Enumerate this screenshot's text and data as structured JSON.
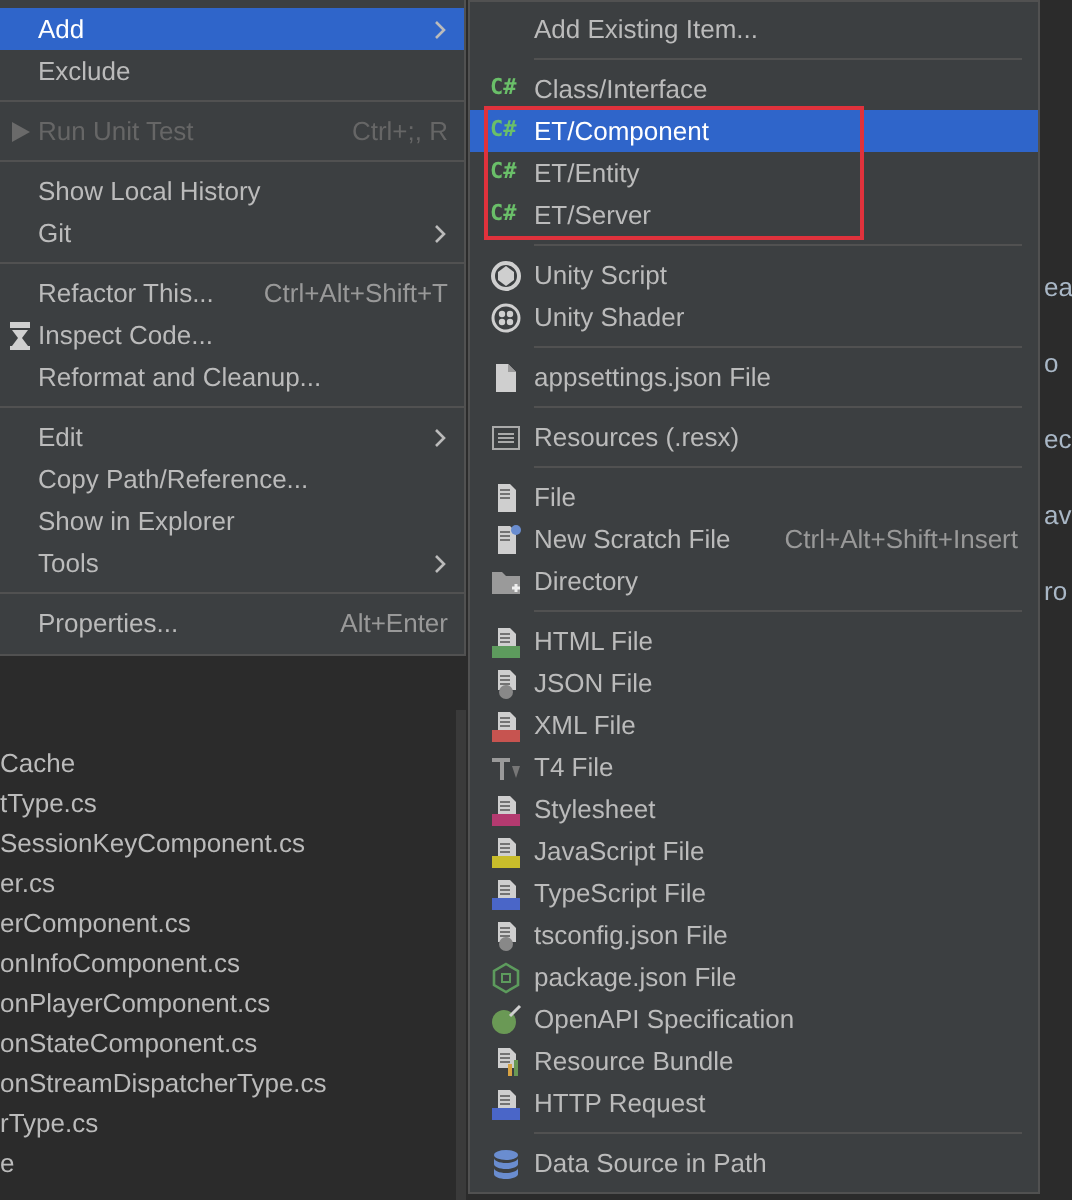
{
  "background_file_list": [
    "Cache",
    "tType.cs",
    "SessionKeyComponent.cs",
    "er.cs",
    "erComponent.cs",
    "onInfoComponent.cs",
    "onPlayerComponent.cs",
    "onStateComponent.cs",
    "onStreamDispatcherType.cs",
    "rType.cs",
    "e"
  ],
  "background_editor_fragments": [
    "ea",
    "o",
    "ec",
    "av",
    "ro"
  ],
  "context_menu": {
    "sections": [
      [
        {
          "label": "Add",
          "selected": true,
          "has_submenu": true,
          "disabled": false
        },
        {
          "label": "Exclude",
          "selected": false,
          "has_submenu": false,
          "disabled": false
        }
      ],
      [
        {
          "label": "Run Unit Test",
          "shortcut": "Ctrl+;, R",
          "kind": "play",
          "selected": false,
          "has_submenu": false,
          "disabled": true
        }
      ],
      [
        {
          "label": "Show Local History",
          "selected": false,
          "has_submenu": false,
          "disabled": false
        },
        {
          "label": "Git",
          "selected": false,
          "has_submenu": true,
          "disabled": false
        }
      ],
      [
        {
          "label": "Refactor This...",
          "shortcut": "Ctrl+Alt+Shift+T",
          "selected": false,
          "has_submenu": false,
          "disabled": false
        },
        {
          "label": "Inspect Code...",
          "kind": "inspect",
          "selected": false,
          "has_submenu": false,
          "disabled": false
        },
        {
          "label": "Reformat and Cleanup...",
          "selected": false,
          "has_submenu": false,
          "disabled": false
        }
      ],
      [
        {
          "label": "Edit",
          "selected": false,
          "has_submenu": true,
          "disabled": false
        },
        {
          "label": "Copy Path/Reference...",
          "selected": false,
          "has_submenu": false,
          "disabled": false
        },
        {
          "label": "Show in Explorer",
          "selected": false,
          "has_submenu": false,
          "disabled": false
        },
        {
          "label": "Tools",
          "selected": false,
          "has_submenu": true,
          "disabled": false
        }
      ],
      [
        {
          "label": "Properties...",
          "shortcut": "Alt+Enter",
          "selected": false,
          "has_submenu": false,
          "disabled": false
        }
      ]
    ]
  },
  "add_submenu": {
    "sections": [
      [
        {
          "label": "Add Existing Item...",
          "selected": false,
          "outlined": false
        }
      ],
      [
        {
          "label": "Class/Interface",
          "badge": "C#",
          "selected": false,
          "outlined": false
        },
        {
          "label": "ET/Component",
          "badge": "C#",
          "selected": true,
          "outlined": true
        },
        {
          "label": "ET/Entity",
          "badge": "C#",
          "selected": false,
          "outlined": true
        },
        {
          "label": "ET/Server",
          "badge": "C#",
          "selected": false,
          "outlined": true
        }
      ],
      [
        {
          "label": "Unity Script",
          "kind": "unity",
          "selected": false,
          "outlined": false
        },
        {
          "label": "Unity Shader",
          "kind": "shader",
          "selected": false,
          "outlined": false
        }
      ],
      [
        {
          "label": "appsettings.json File",
          "kind": "page",
          "selected": false,
          "outlined": false
        }
      ],
      [
        {
          "label": "Resources (.resx)",
          "kind": "resx",
          "selected": false,
          "outlined": false
        }
      ],
      [
        {
          "label": "File",
          "kind": "doc",
          "selected": false,
          "outlined": false
        },
        {
          "label": "New Scratch File",
          "shortcut": "Ctrl+Alt+Shift+Insert",
          "kind": "scratch",
          "selected": false,
          "outlined": false
        },
        {
          "label": "Directory",
          "kind": "folder",
          "selected": false,
          "outlined": false
        }
      ],
      [
        {
          "label": "HTML File",
          "kind": "html",
          "selected": false,
          "outlined": false
        },
        {
          "label": "JSON File",
          "kind": "json",
          "selected": false,
          "outlined": false
        },
        {
          "label": "XML File",
          "kind": "xml",
          "selected": false,
          "outlined": false
        },
        {
          "label": "T4 File",
          "kind": "t4",
          "selected": false,
          "outlined": false
        },
        {
          "label": "Stylesheet",
          "kind": "css",
          "selected": false,
          "outlined": false
        },
        {
          "label": "JavaScript File",
          "kind": "js",
          "selected": false,
          "outlined": false
        },
        {
          "label": "TypeScript File",
          "kind": "ts",
          "selected": false,
          "outlined": false
        },
        {
          "label": "tsconfig.json File",
          "kind": "json",
          "selected": false,
          "outlined": false
        },
        {
          "label": "package.json File",
          "kind": "npm",
          "selected": false,
          "outlined": false
        },
        {
          "label": "OpenAPI Specification",
          "kind": "openapi",
          "selected": false,
          "outlined": false
        },
        {
          "label": "Resource Bundle",
          "kind": "bundle",
          "selected": false,
          "outlined": false
        },
        {
          "label": "HTTP Request",
          "kind": "api",
          "selected": false,
          "outlined": false
        }
      ],
      [
        {
          "label": "Data Source in Path",
          "kind": "db",
          "selected": false,
          "outlined": false
        }
      ]
    ]
  }
}
